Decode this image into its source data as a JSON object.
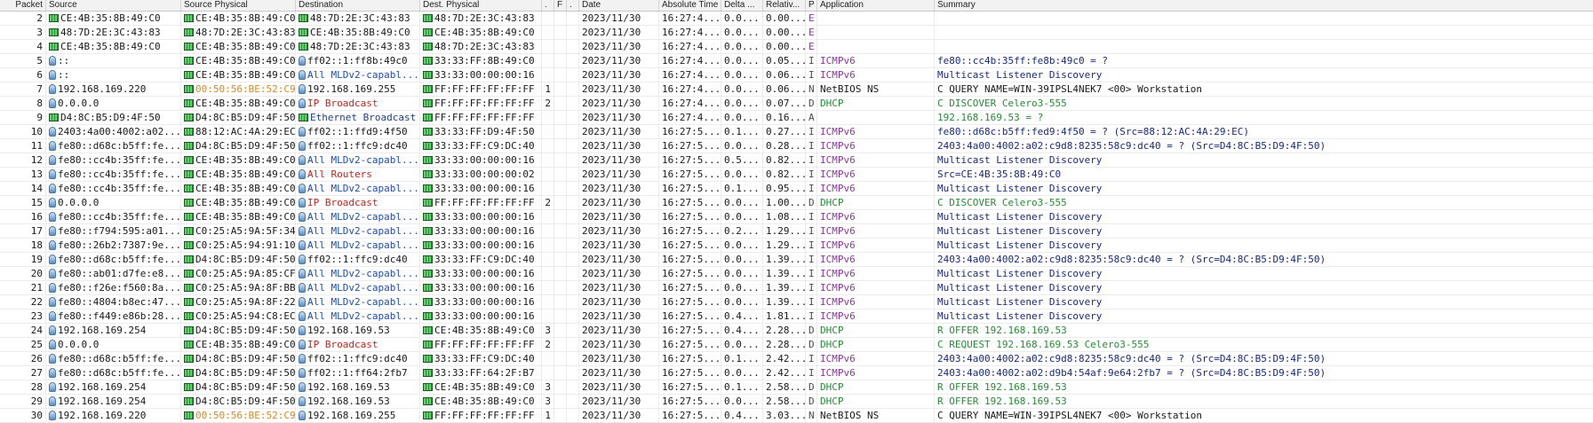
{
  "headers": {
    "packet": "Packet",
    "source": "Source",
    "source_physical": "Source Physical",
    "destination": "Destination",
    "dest_physical": "Dest. Physical",
    "flag1": ".",
    "flag2": "F",
    "flag3": ".",
    "date": "Date",
    "absolute_time": "Absolute Time",
    "delta": "Delta ...",
    "relative": "Relativ...",
    "proto": "P",
    "application": "Application",
    "summary": "Summary"
  },
  "colors": {
    "nic_icon": "#2e8b3a",
    "address_blue": "#1f4fa8",
    "broadcast_red": "#c0261f",
    "vendor_orange": "#d88a1e",
    "icmp_purple": "#8a3a9a",
    "dhcp_green": "#2a8a3a"
  },
  "rows": [
    {
      "pkt": "2",
      "src": "CE:4B:35:8B:49:C0",
      "src_icon": "nic-icon",
      "sp": "CE:4B:35:8B:49:C0",
      "dst": "48:7D:2E:3C:43:83",
      "dst_icon": "nic-icon",
      "dp": "48:7D:2E:3C:43:83",
      "f1": "",
      "f2": "",
      ".": ".",
      "date": "2023/11/30",
      "abs": "16:27:4...",
      "delta": "0.0...",
      "rel": "0.00...",
      "p": "E",
      "app": "",
      "sum": ""
    },
    {
      "pkt": "3",
      "src": "48:7D:2E:3C:43:83",
      "src_icon": "nic-icon",
      "sp": "48:7D:2E:3C:43:83",
      "dst": "CE:4B:35:8B:49:C0",
      "dst_icon": "nic-icon",
      "dp": "CE:4B:35:8B:49:C0",
      "f1": "",
      "f2": "",
      ".": ".",
      "date": "2023/11/30",
      "abs": "16:27:4...",
      "delta": "0.0...",
      "rel": "0.00...",
      "p": "E",
      "app": "",
      "sum": ""
    },
    {
      "pkt": "4",
      "src": "CE:4B:35:8B:49:C0",
      "src_icon": "nic-icon",
      "sp": "CE:4B:35:8B:49:C0",
      "dst": "48:7D:2E:3C:43:83",
      "dst_icon": "nic-icon",
      "dp": "48:7D:2E:3C:43:83",
      "f1": "",
      "f2": "",
      ".": ".",
      "date": "2023/11/30",
      "abs": "16:27:4...",
      "delta": "0.0...",
      "rel": "0.00...",
      "p": "E",
      "app": "",
      "sum": ""
    },
    {
      "pkt": "5",
      "src": "::",
      "src_icon": "globe-icon",
      "sp": "CE:4B:35:8B:49:C0",
      "dst": "ff02::1:ff8b:49c0",
      "dst_icon": "globe-icon",
      "dp": "33:33:FF:8B:49:C0",
      "f1": "",
      "f2": "",
      ".": ".",
      "date": "2023/11/30",
      "abs": "16:27:4...",
      "delta": "0.0...",
      "rel": "0.05...",
      "p": "I",
      "app": "ICMPv6",
      "sum": "fe80::cc4b:35ff:fe8b:49c0 = ?"
    },
    {
      "pkt": "6",
      "src": "::",
      "src_icon": "globe-icon",
      "sp": "CE:4B:35:8B:49:C0",
      "dst": "All MLDv2-capabl...",
      "dst_icon": "globe-icon",
      "dp": "33:33:00:00:00:16",
      "f1": "",
      "f2": "",
      ".": ".",
      "date": "2023/11/30",
      "abs": "16:27:4...",
      "delta": "0.0...",
      "rel": "0.06...",
      "p": "I",
      "app": "ICMPv6",
      "sum": "Multicast Listener Discovery"
    },
    {
      "pkt": "7",
      "src": "192.168.169.220",
      "src_icon": "globe-icon",
      "sp": "00:50:56:BE:52:C9",
      "dst": "192.168.169.255",
      "dst_icon": "globe-icon",
      "dp": "FF:FF:FF:FF:FF:FF",
      "f1": "1",
      "f2": "",
      ".": ".",
      "date": "2023/11/30",
      "abs": "16:27:4...",
      "delta": "0.0...",
      "rel": "0.06...",
      "p": "N",
      "app": "NetBIOS NS",
      "sum": "C QUERY NAME=WIN-39IPSL4NEK7 <00> Workstation"
    },
    {
      "pkt": "8",
      "src": "0.0.0.0",
      "src_icon": "globe-icon",
      "sp": "CE:4B:35:8B:49:C0",
      "dst": "IP Broadcast",
      "dst_icon": "globe-icon",
      "dp": "FF:FF:FF:FF:FF:FF",
      "f1": "2",
      "f2": "",
      ".": ".",
      "date": "2023/11/30",
      "abs": "16:27:4...",
      "delta": "0.0...",
      "rel": "0.07...",
      "p": "D",
      "app": "DHCP",
      "sum": "C DISCOVER  Celero3-555"
    },
    {
      "pkt": "9",
      "src": "D4:8C:B5:D9:4F:50",
      "src_icon": "nic-icon",
      "sp": "D4:8C:B5:D9:4F:50",
      "dst": "Ethernet Broadcast",
      "dst_icon": "nic-icon",
      "dp": "FF:FF:FF:FF:FF:FF",
      "f1": "",
      "f2": "",
      ".": ".",
      "date": "2023/11/30",
      "abs": "16:27:4...",
      "delta": "0.0...",
      "rel": "0.16...",
      "p": "A",
      "app": "",
      "sum": "192.168.169.53 = ?"
    },
    {
      "pkt": "10",
      "src": "2403:4a00:4002:a02...",
      "src_icon": "globe-icon",
      "sp": "88:12:AC:4A:29:EC",
      "dst": "ff02::1:ffd9:4f50",
      "dst_icon": "globe-icon",
      "dp": "33:33:FF:D9:4F:50",
      "f1": "",
      "f2": "",
      ".": ".",
      "date": "2023/11/30",
      "abs": "16:27:5...",
      "delta": "0.1...",
      "rel": "0.27...",
      "p": "I",
      "app": "ICMPv6",
      "sum": "fe80::d68c:b5ff:fed9:4f50 = ? (Src=88:12:AC:4A:29:EC)"
    },
    {
      "pkt": "11",
      "src": "fe80::d68c:b5ff:fe...",
      "src_icon": "globe-icon",
      "sp": "D4:8C:B5:D9:4F:50",
      "dst": "ff02::1:ffc9:dc40",
      "dst_icon": "globe-icon",
      "dp": "33:33:FF:C9:DC:40",
      "f1": "",
      "f2": "",
      ".": ".",
      "date": "2023/11/30",
      "abs": "16:27:5...",
      "delta": "0.0...",
      "rel": "0.28...",
      "p": "I",
      "app": "ICMPv6",
      "sum": "2403:4a00:4002:a02:c9d8:8235:58c9:dc40 = ? (Src=D4:8C:B5:D9:4F:50)"
    },
    {
      "pkt": "12",
      "src": "fe80::cc4b:35ff:fe...",
      "src_icon": "globe-icon",
      "sp": "CE:4B:35:8B:49:C0",
      "dst": "All MLDv2-capabl...",
      "dst_icon": "globe-icon",
      "dp": "33:33:00:00:00:16",
      "f1": "",
      "f2": "",
      ".": ".",
      "date": "2023/11/30",
      "abs": "16:27:5...",
      "delta": "0.5...",
      "rel": "0.82...",
      "p": "I",
      "app": "ICMPv6",
      "sum": "Multicast Listener Discovery"
    },
    {
      "pkt": "13",
      "src": "fe80::cc4b:35ff:fe...",
      "src_icon": "globe-icon",
      "sp": "CE:4B:35:8B:49:C0",
      "dst": "All Routers",
      "dst_icon": "globe-icon",
      "dp": "33:33:00:00:00:02",
      "f1": "",
      "f2": "",
      ".": ".",
      "date": "2023/11/30",
      "abs": "16:27:5...",
      "delta": "0.0...",
      "rel": "0.82...",
      "p": "I",
      "app": "ICMPv6",
      "sum": "Src=CE:4B:35:8B:49:C0"
    },
    {
      "pkt": "14",
      "src": "fe80::cc4b:35ff:fe...",
      "src_icon": "globe-icon",
      "sp": "CE:4B:35:8B:49:C0",
      "dst": "All MLDv2-capabl...",
      "dst_icon": "globe-icon",
      "dp": "33:33:00:00:00:16",
      "f1": "",
      "f2": "",
      ".": ".",
      "date": "2023/11/30",
      "abs": "16:27:5...",
      "delta": "0.1...",
      "rel": "0.95...",
      "p": "I",
      "app": "ICMPv6",
      "sum": "Multicast Listener Discovery"
    },
    {
      "pkt": "15",
      "src": "0.0.0.0",
      "src_icon": "globe-icon",
      "sp": "CE:4B:35:8B:49:C0",
      "dst": "IP Broadcast",
      "dst_icon": "globe-icon",
      "dp": "FF:FF:FF:FF:FF:FF",
      "f1": "2",
      "f2": "",
      ".": ".",
      "date": "2023/11/30",
      "abs": "16:27:5...",
      "delta": "0.0...",
      "rel": "1.00...",
      "p": "D",
      "app": "DHCP",
      "sum": "C DISCOVER  Celero3-555"
    },
    {
      "pkt": "16",
      "src": "fe80::cc4b:35ff:fe...",
      "src_icon": "globe-icon",
      "sp": "CE:4B:35:8B:49:C0",
      "dst": "All MLDv2-capabl...",
      "dst_icon": "globe-icon",
      "dp": "33:33:00:00:00:16",
      "f1": "",
      "f2": "",
      ".": ".",
      "date": "2023/11/30",
      "abs": "16:27:5...",
      "delta": "0.0...",
      "rel": "1.08...",
      "p": "I",
      "app": "ICMPv6",
      "sum": "Multicast Listener Discovery"
    },
    {
      "pkt": "17",
      "src": "fe80::f794:595:a01...",
      "src_icon": "globe-icon",
      "sp": "C0:25:A5:9A:5F:34",
      "dst": "All MLDv2-capabl...",
      "dst_icon": "globe-icon",
      "dp": "33:33:00:00:00:16",
      "f1": "",
      "f2": "",
      ".": ".",
      "date": "2023/11/30",
      "abs": "16:27:5...",
      "delta": "0.2...",
      "rel": "1.29...",
      "p": "I",
      "app": "ICMPv6",
      "sum": "Multicast Listener Discovery"
    },
    {
      "pkt": "18",
      "src": "fe80::26b2:7387:9e...",
      "src_icon": "globe-icon",
      "sp": "C0:25:A5:94:91:10",
      "dst": "All MLDv2-capabl...",
      "dst_icon": "globe-icon",
      "dp": "33:33:00:00:00:16",
      "f1": "",
      "f2": "",
      ".": ".",
      "date": "2023/11/30",
      "abs": "16:27:5...",
      "delta": "0.0...",
      "rel": "1.29...",
      "p": "I",
      "app": "ICMPv6",
      "sum": "Multicast Listener Discovery"
    },
    {
      "pkt": "19",
      "src": "fe80::d68c:b5ff:fe...",
      "src_icon": "globe-icon",
      "sp": "D4:8C:B5:D9:4F:50",
      "dst": "ff02::1:ffc9:dc40",
      "dst_icon": "globe-icon",
      "dp": "33:33:FF:C9:DC:40",
      "f1": "",
      "f2": "",
      ".": ".",
      "date": "2023/11/30",
      "abs": "16:27:5...",
      "delta": "0.0...",
      "rel": "1.39...",
      "p": "I",
      "app": "ICMPv6",
      "sum": "2403:4a00:4002:a02:c9d8:8235:58c9:dc40 = ? (Src=D4:8C:B5:D9:4F:50)"
    },
    {
      "pkt": "20",
      "src": "fe80::ab01:d7fe:e8...",
      "src_icon": "globe-icon",
      "sp": "C0:25:A5:9A:85:CF",
      "dst": "All MLDv2-capabl...",
      "dst_icon": "globe-icon",
      "dp": "33:33:00:00:00:16",
      "f1": "",
      "f2": "",
      ".": ".",
      "date": "2023/11/30",
      "abs": "16:27:5...",
      "delta": "0.0...",
      "rel": "1.39...",
      "p": "I",
      "app": "ICMPv6",
      "sum": "Multicast Listener Discovery"
    },
    {
      "pkt": "21",
      "src": "fe80::f26e:f560:8a...",
      "src_icon": "globe-icon",
      "sp": "C0:25:A5:9A:8F:BB",
      "dst": "All MLDv2-capabl...",
      "dst_icon": "globe-icon",
      "dp": "33:33:00:00:00:16",
      "f1": "",
      "f2": "",
      ".": ".",
      "date": "2023/11/30",
      "abs": "16:27:5...",
      "delta": "0.0...",
      "rel": "1.39...",
      "p": "I",
      "app": "ICMPv6",
      "sum": "Multicast Listener Discovery"
    },
    {
      "pkt": "22",
      "src": "fe80::4804:b8ec:47...",
      "src_icon": "globe-icon",
      "sp": "C0:25:A5:9A:8F:22",
      "dst": "All MLDv2-capabl...",
      "dst_icon": "globe-icon",
      "dp": "33:33:00:00:00:16",
      "f1": "",
      "f2": "",
      ".": ".",
      "date": "2023/11/30",
      "abs": "16:27:5...",
      "delta": "0.0...",
      "rel": "1.39...",
      "p": "I",
      "app": "ICMPv6",
      "sum": "Multicast Listener Discovery"
    },
    {
      "pkt": "23",
      "src": "fe80::f449:e86b:28...",
      "src_icon": "globe-icon",
      "sp": "C0:25:A5:94:C8:EC",
      "dst": "All MLDv2-capabl...",
      "dst_icon": "globe-icon",
      "dp": "33:33:00:00:00:16",
      "f1": "",
      "f2": "",
      ".": ".",
      "date": "2023/11/30",
      "abs": "16:27:5...",
      "delta": "0.4...",
      "rel": "1.81...",
      "p": "I",
      "app": "ICMPv6",
      "sum": "Multicast Listener Discovery"
    },
    {
      "pkt": "24",
      "src": "192.168.169.254",
      "src_icon": "globe-icon",
      "sp": "D4:8C:B5:D9:4F:50",
      "dst": "192.168.169.53",
      "dst_icon": "globe-icon",
      "dp": "CE:4B:35:8B:49:C0",
      "f1": "3",
      "f2": "",
      ".": ".",
      "date": "2023/11/30",
      "abs": "16:27:5...",
      "delta": "0.4...",
      "rel": "2.28...",
      "p": "D",
      "app": "DHCP",
      "sum": "R OFFER 192.168.169.53"
    },
    {
      "pkt": "25",
      "src": "0.0.0.0",
      "src_icon": "globe-icon",
      "sp": "CE:4B:35:8B:49:C0",
      "dst": "IP Broadcast",
      "dst_icon": "globe-icon",
      "dp": "FF:FF:FF:FF:FF:FF",
      "f1": "2",
      "f2": "",
      ".": ".",
      "date": "2023/11/30",
      "abs": "16:27:5...",
      "delta": "0.0...",
      "rel": "2.28...",
      "p": "D",
      "app": "DHCP",
      "sum": "C REQUEST 192.168.169.53 Celero3-555"
    },
    {
      "pkt": "26",
      "src": "fe80::d68c:b5ff:fe...",
      "src_icon": "globe-icon",
      "sp": "D4:8C:B5:D9:4F:50",
      "dst": "ff02::1:ffc9:dc40",
      "dst_icon": "globe-icon",
      "dp": "33:33:FF:C9:DC:40",
      "f1": "",
      "f2": "",
      ".": ".",
      "date": "2023/11/30",
      "abs": "16:27:5...",
      "delta": "0.1...",
      "rel": "2.42...",
      "p": "I",
      "app": "ICMPv6",
      "sum": "2403:4a00:4002:a02:c9d8:8235:58c9:dc40 = ? (Src=D4:8C:B5:D9:4F:50)"
    },
    {
      "pkt": "27",
      "src": "fe80::d68c:b5ff:fe...",
      "src_icon": "globe-icon",
      "sp": "D4:8C:B5:D9:4F:50",
      "dst": "ff02::1:ff64:2fb7",
      "dst_icon": "globe-icon",
      "dp": "33:33:FF:64:2F:B7",
      "f1": "",
      "f2": "",
      ".": ".",
      "date": "2023/11/30",
      "abs": "16:27:5...",
      "delta": "0.0...",
      "rel": "2.42...",
      "p": "I",
      "app": "ICMPv6",
      "sum": "2403:4a00:4002:a02:d9b4:54af:9e64:2fb7 = ? (Src=D4:8C:B5:D9:4F:50)"
    },
    {
      "pkt": "28",
      "src": "192.168.169.254",
      "src_icon": "globe-icon",
      "sp": "D4:8C:B5:D9:4F:50",
      "dst": "192.168.169.53",
      "dst_icon": "globe-icon",
      "dp": "CE:4B:35:8B:49:C0",
      "f1": "3",
      "f2": "",
      ".": ".",
      "date": "2023/11/30",
      "abs": "16:27:5...",
      "delta": "0.1...",
      "rel": "2.58...",
      "p": "D",
      "app": "DHCP",
      "sum": "R OFFER 192.168.169.53"
    },
    {
      "pkt": "29",
      "src": "192.168.169.254",
      "src_icon": "globe-icon",
      "sp": "D4:8C:B5:D9:4F:50",
      "dst": "192.168.169.53",
      "dst_icon": "globe-icon",
      "dp": "CE:4B:35:8B:49:C0",
      "f1": "3",
      "f2": "",
      ".": ".",
      "date": "2023/11/30",
      "abs": "16:27:5...",
      "delta": "0.0...",
      "rel": "2.58...",
      "p": "D",
      "app": "DHCP",
      "sum": "R OFFER 192.168.169.53"
    },
    {
      "pkt": "30",
      "src": "192.168.169.220",
      "src_icon": "globe-icon",
      "sp": "00:50:56:BE:52:C9",
      "dst": "192.168.169.255",
      "dst_icon": "globe-icon",
      "dp": "FF:FF:FF:FF:FF:FF",
      "f1": "1",
      "f2": "",
      ".": ".",
      "date": "2023/11/30",
      "abs": "16:27:5...",
      "delta": "0.4...",
      "rel": "3.03...",
      "p": "N",
      "app": "NetBIOS NS",
      "sum": "C QUERY NAME=WIN-39IPSL4NEK7 <00> Workstation"
    }
  ]
}
